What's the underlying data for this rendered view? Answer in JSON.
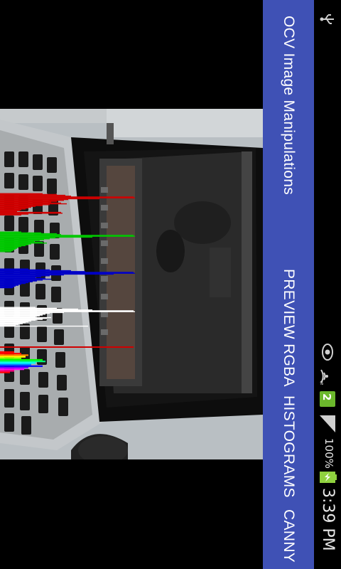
{
  "status_bar": {
    "time": "3:39 PM",
    "battery_percent": "100%",
    "notification_badge": "2",
    "icons": [
      "usb-icon",
      "eye-icon",
      "wifi-icon",
      "notification-icon",
      "signal-icon",
      "battery-icon"
    ]
  },
  "action_bar": {
    "title": "OCV Image Manipulations",
    "actions": [
      "PREVIEW RGBA",
      "HISTOGRAMS",
      "CANNY"
    ],
    "color": "#3f51b5"
  },
  "preview": {
    "histogram_channels": [
      "red",
      "green",
      "blue",
      "luminance",
      "hue"
    ],
    "colors": {
      "red": "#d00000",
      "green": "#00c800",
      "blue": "#0000c8",
      "luminance": "#ffffff"
    }
  }
}
